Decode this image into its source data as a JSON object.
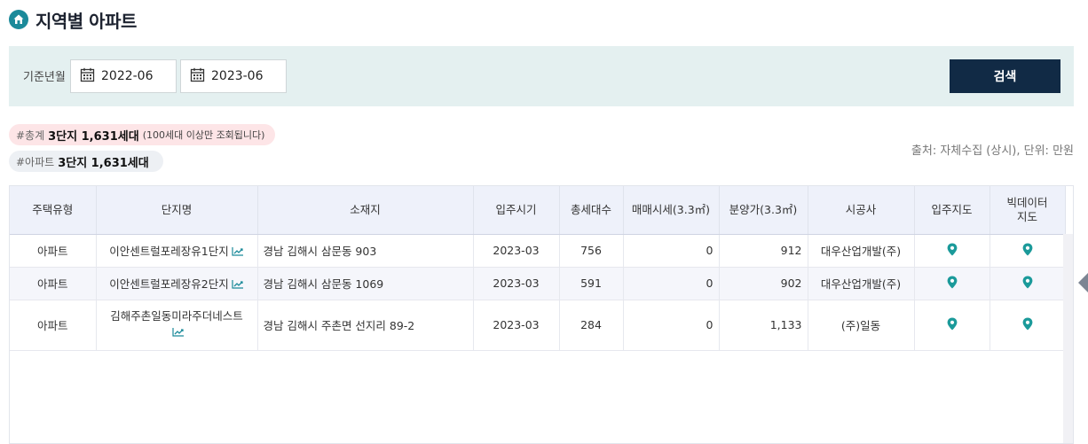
{
  "page": {
    "title": "지역별 아파트",
    "icon": "home-icon"
  },
  "filter": {
    "label": "기준년월",
    "start": "2022-06",
    "end": "2023-06",
    "search_label": "검색"
  },
  "summary": {
    "total_prefix": "#총계",
    "total_value": "3단지 1,631세대",
    "total_note": "(100세대 이상만 조회됩니다)",
    "apt_prefix": "#아파트",
    "apt_value": "3단지 1,631세대",
    "source": "출처: 자체수집 (상시), 단위: 만원"
  },
  "table": {
    "headers": [
      "주택유형",
      "단지명",
      "소재지",
      "입주시기",
      "총세대수",
      "매매시세(3.3㎡)",
      "분양가(3.3㎡)",
      "시공사",
      "입주지도",
      "빅데이터\n지도"
    ],
    "rows": [
      {
        "type": "아파트",
        "name": "이안센트럴포레장유1단지",
        "addr": "경남 김해시 삼문동 903",
        "date": "2023-03",
        "units": "756",
        "sale": "0",
        "presale": "912",
        "builder": "대우산업개발(주)"
      },
      {
        "type": "아파트",
        "name": "이안센트럴포레장유2단지",
        "addr": "경남 김해시 삼문동 1069",
        "date": "2023-03",
        "units": "591",
        "sale": "0",
        "presale": "902",
        "builder": "대우산업개발(주)"
      },
      {
        "type": "아파트",
        "name": "김해주촌일동미라주더네스트",
        "addr": "경남 김해시 주촌면 선지리 89-2",
        "date": "2023-03",
        "units": "284",
        "sale": "0",
        "presale": "1,133",
        "builder": "(주)일동"
      }
    ]
  },
  "colors": {
    "accent": "#1b8a9a",
    "button": "#112a45",
    "filter_bg": "#e4f0f0",
    "pill_pink": "#fde5e7"
  }
}
